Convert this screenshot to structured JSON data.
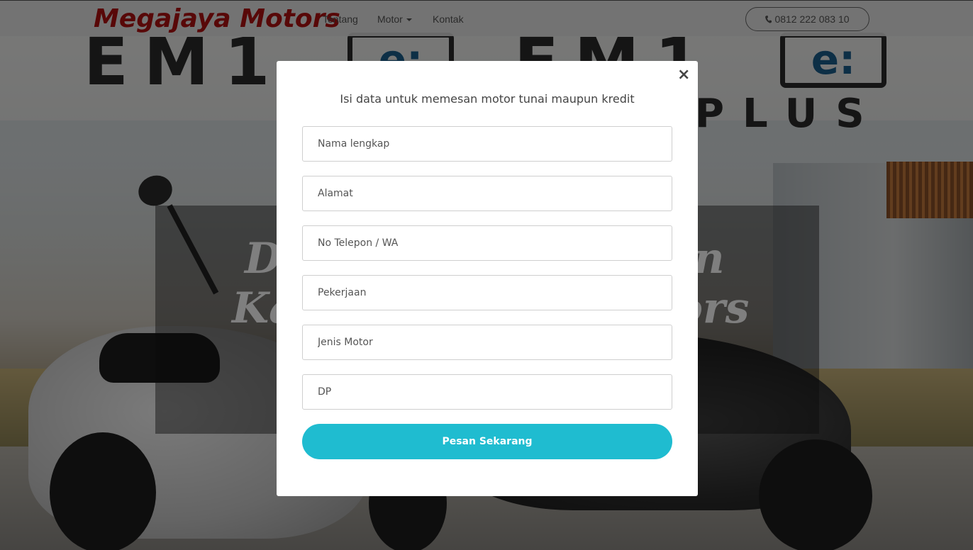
{
  "navbar": {
    "brand": "Megajaya Motors",
    "links": [
      "Tentang",
      "Motor",
      "Kontak"
    ],
    "phone": "0812 222 083 10"
  },
  "hero": {
    "logo_text": "EM1",
    "logo_box_text": "e:",
    "logo_plus": "PLUS",
    "title_partial": "D                   an\nKa                      ors"
  },
  "modal": {
    "title": "Isi data untuk memesan motor tunai maupun kredit",
    "close_symbol": "×",
    "fields": [
      {
        "placeholder": "Nama lengkap",
        "value": ""
      },
      {
        "placeholder": "Alamat",
        "value": ""
      },
      {
        "placeholder": "No Telepon / WA",
        "value": ""
      },
      {
        "placeholder": "Pekerjaan",
        "value": ""
      },
      {
        "placeholder": "Jenis Motor",
        "value": ""
      },
      {
        "placeholder": "DP",
        "value": ""
      }
    ],
    "submit_label": "Pesan Sekarang"
  },
  "colors": {
    "brand": "#b01010",
    "accent": "#1fbcd0",
    "overlay": "rgba(0,0,0,0.5)"
  }
}
